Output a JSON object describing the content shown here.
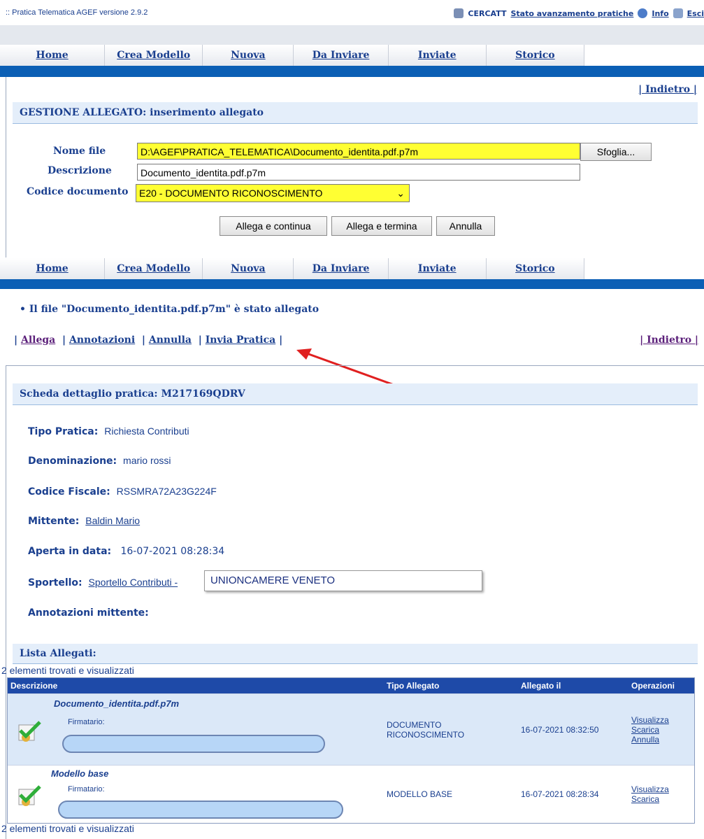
{
  "header": {
    "version": ":: Pratica Telematica AGEF versione 2.9.2",
    "links": [
      "CERCATT",
      "Stato avanzamento pratiche",
      "Info",
      "Esci"
    ]
  },
  "nav": [
    "Home",
    "Crea Modello",
    "Nuova",
    "Da Inviare",
    "Inviate",
    "Storico"
  ],
  "back_link": "| Indietro |",
  "form": {
    "title": "GESTIONE ALLEGATO: inserimento allegato",
    "nome_file_label": "Nome file",
    "nome_file_value": "D:\\AGEF\\PRATICA_TELEMATICA\\Documento_identita.pdf.p7m",
    "browse_label": "Sfoglia...",
    "descrizione_label": "Descrizione",
    "descrizione_value": "Documento_identita.pdf.p7m",
    "codice_label": "Codice documento",
    "codice_value": "E20 - DOCUMENTO RICONOSCIMENTO",
    "buttons": [
      "Allega e continua",
      "Allega e termina",
      "Annulla"
    ]
  },
  "message": "Il file \"Documento_identita.pdf.p7m\" è stato allegato",
  "actions": {
    "sep": "|",
    "allega": "Allega",
    "annotazioni": "Annotazioni",
    "annulla": "Annulla",
    "invia": "Invia Pratica"
  },
  "detail": {
    "title": "Scheda dettaglio pratica: M217169QDRV",
    "tipo_k": "Tipo Pratica:",
    "tipo_v": "Richiesta Contributi",
    "denom_k": "Denominazione:",
    "denom_v": "mario rossi",
    "cf_k": "Codice Fiscale:",
    "cf_v": "RSSMRA72A23G224F",
    "mitt_k": "Mittente:",
    "mitt_v": "Baldin Mario",
    "aperta_k": "Aperta in data:",
    "aperta_v": "16-07-2021 08:28:34",
    "sport_k": "Sportello:",
    "sport_v": "Sportello Contributi -",
    "sport_tip": "UNIONCAMERE VENETO",
    "annot_k": "Annotazioni mittente:"
  },
  "allegati": {
    "title": "Lista Allegati:",
    "count": "2 elementi trovati e visualizzati",
    "columns": [
      "Descrizione",
      "Tipo Allegato",
      "Allegato il",
      "Operazioni"
    ],
    "firmatario": "Firmatario:",
    "rows": [
      {
        "name": "Documento_identita.pdf.p7m",
        "tipo": "DOCUMENTO RICONOSCIMENTO",
        "date": "16-07-2021 08:32:50",
        "ops": [
          "Visualizza",
          "Scarica",
          "Annulla"
        ]
      },
      {
        "name": "Modello base",
        "tipo": "MODELLO BASE",
        "date": "16-07-2021 08:28:34",
        "ops": [
          "Visualizza",
          "Scarica"
        ]
      }
    ]
  },
  "colors": {
    "nav_blue": "#0b5fb5",
    "link": "#1a3f8f",
    "highlight": "#ffff33",
    "header_th": "#1e4aa8"
  }
}
